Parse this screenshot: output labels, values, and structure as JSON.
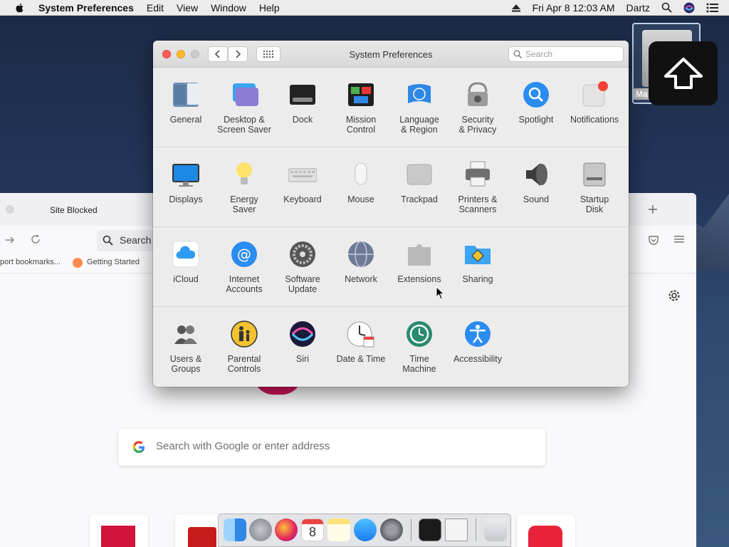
{
  "menubar": {
    "app_name": "System Preferences",
    "items": [
      "Edit",
      "View",
      "Window",
      "Help"
    ],
    "datetime": "Fri Apr 8  12:03 AM",
    "user": "Dartz"
  },
  "desktop": {
    "drive_label": "Ma"
  },
  "browser": {
    "tab_title": "Site Blocked",
    "url_placeholder": "Search",
    "bookmarks": [
      "port bookmarks...",
      "Getting Started"
    ],
    "search_placeholder": "Search with Google or enter address"
  },
  "sysprefs": {
    "title": "System Preferences",
    "search_placeholder": "Search",
    "rows": [
      [
        {
          "label": "General",
          "icon": "general-icon"
        },
        {
          "label": "Desktop &\nScreen Saver",
          "icon": "desktop-icon"
        },
        {
          "label": "Dock",
          "icon": "dock-icon"
        },
        {
          "label": "Mission\nControl",
          "icon": "mission-control-icon"
        },
        {
          "label": "Language\n& Region",
          "icon": "language-icon"
        },
        {
          "label": "Security\n& Privacy",
          "icon": "security-icon"
        },
        {
          "label": "Spotlight",
          "icon": "spotlight-icon"
        },
        {
          "label": "Notifications",
          "icon": "notifications-icon"
        }
      ],
      [
        {
          "label": "Displays",
          "icon": "displays-icon"
        },
        {
          "label": "Energy\nSaver",
          "icon": "energy-icon"
        },
        {
          "label": "Keyboard",
          "icon": "keyboard-icon"
        },
        {
          "label": "Mouse",
          "icon": "mouse-icon"
        },
        {
          "label": "Trackpad",
          "icon": "trackpad-icon"
        },
        {
          "label": "Printers &\nScanners",
          "icon": "printer-icon"
        },
        {
          "label": "Sound",
          "icon": "sound-icon"
        },
        {
          "label": "Startup\nDisk",
          "icon": "startup-disk-icon"
        }
      ],
      [
        {
          "label": "iCloud",
          "icon": "icloud-icon"
        },
        {
          "label": "Internet\nAccounts",
          "icon": "internet-accounts-icon"
        },
        {
          "label": "Software\nUpdate",
          "icon": "software-update-icon"
        },
        {
          "label": "Network",
          "icon": "network-icon"
        },
        {
          "label": "Extensions",
          "icon": "extensions-icon"
        },
        {
          "label": "Sharing",
          "icon": "sharing-icon"
        }
      ],
      [
        {
          "label": "Users &\nGroups",
          "icon": "users-icon"
        },
        {
          "label": "Parental\nControls",
          "icon": "parental-icon"
        },
        {
          "label": "Siri",
          "icon": "siri-icon"
        },
        {
          "label": "Date & Time",
          "icon": "date-time-icon"
        },
        {
          "label": "Time\nMachine",
          "icon": "time-machine-icon"
        },
        {
          "label": "Accessibility",
          "icon": "accessibility-icon"
        }
      ]
    ]
  },
  "dock": {
    "items": [
      "finder-icon",
      "launchpad-icon",
      "firefox-icon",
      "calendar-icon",
      "notes-icon",
      "app-store-icon",
      "system-preferences-icon",
      "terminal-icon",
      "document-icon",
      "trash-icon"
    ],
    "calendar_day": "8"
  },
  "colors": {
    "accent": "#1a84ff",
    "close": "#fd5f57",
    "minimize": "#fdbc2e"
  }
}
